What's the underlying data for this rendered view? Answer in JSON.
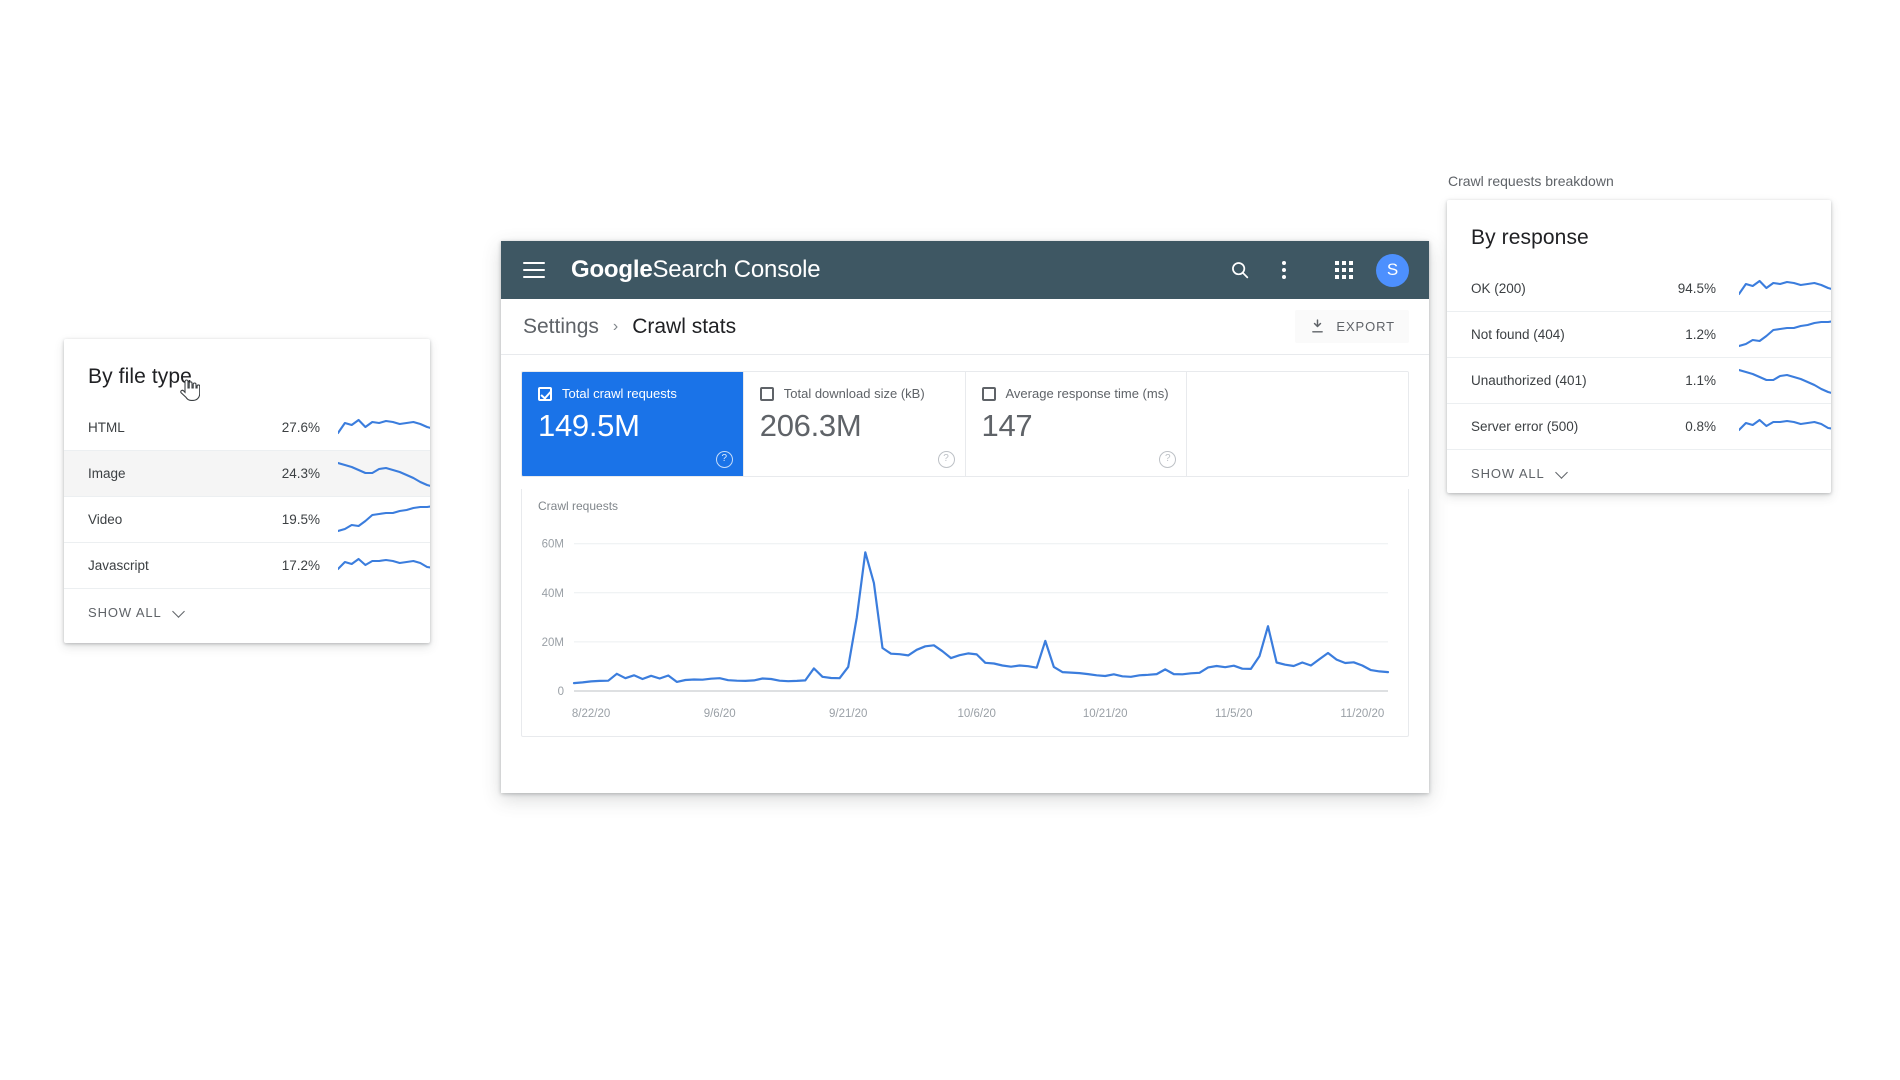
{
  "app": {
    "brand_bold": "Google",
    "brand_light": "Search Console",
    "header_bg": "#3e5763",
    "accent": "#1a73e8",
    "avatar_letter": "S",
    "avatar_bg": "#4d90fe",
    "icons": {
      "menu": "hamburger-icon",
      "search": "search-icon",
      "overflow": "more-vert-icon",
      "apps": "apps-grid-icon"
    }
  },
  "breadcrumb": {
    "parent": "Settings",
    "separator": "›",
    "current": "Crawl stats"
  },
  "export": {
    "label": "EXPORT",
    "icon": "download-icon"
  },
  "metrics": [
    {
      "name": "Total crawl requests",
      "value": "149.5M",
      "checked": true,
      "active": true,
      "help": "?"
    },
    {
      "name": "Total download size (kB)",
      "value": "206.3M",
      "checked": false,
      "active": false,
      "help": "?"
    },
    {
      "name": "Average response time (ms)",
      "value": "147",
      "checked": false,
      "active": false,
      "help": "?"
    }
  ],
  "chart_data": {
    "type": "line",
    "title": "Crawl requests",
    "xlabel": "",
    "ylabel": "",
    "grid": true,
    "legend": "none",
    "line_color": "#3b7ddd",
    "ylim": [
      0,
      66000000
    ],
    "yticks": [
      0,
      20000000,
      40000000,
      60000000
    ],
    "ytick_labels": [
      "0",
      "20M",
      "40M",
      "60M"
    ],
    "xtick_labels": [
      "8/22/20",
      "9/6/20",
      "9/21/20",
      "10/6/20",
      "10/21/20",
      "11/5/20",
      "11/20/20"
    ],
    "xtick_indices": [
      2,
      17,
      32,
      47,
      62,
      77,
      92
    ],
    "x": [
      "8/20/20",
      "8/21/20",
      "8/22/20",
      "8/23/20",
      "8/24/20",
      "8/25/20",
      "8/26/20",
      "8/27/20",
      "8/28/20",
      "8/29/20",
      "8/30/20",
      "8/31/20",
      "9/1/20",
      "9/2/20",
      "9/3/20",
      "9/4/20",
      "9/5/20",
      "9/6/20",
      "9/7/20",
      "9/8/20",
      "9/9/20",
      "9/10/20",
      "9/11/20",
      "9/12/20",
      "9/13/20",
      "9/14/20",
      "9/15/20",
      "9/16/20",
      "9/17/20",
      "9/18/20",
      "9/19/20",
      "9/20/20",
      "9/21/20",
      "9/22/20",
      "9/23/20",
      "9/24/20",
      "9/25/20",
      "9/26/20",
      "9/27/20",
      "9/28/20",
      "9/29/20",
      "9/30/20",
      "10/1/20",
      "10/2/20",
      "10/3/20",
      "10/4/20",
      "10/5/20",
      "10/6/20",
      "10/7/20",
      "10/8/20",
      "10/9/20",
      "10/10/20",
      "10/11/20",
      "10/12/20",
      "10/13/20",
      "10/14/20",
      "10/15/20",
      "10/16/20",
      "10/17/20",
      "10/18/20",
      "10/19/20",
      "10/20/20",
      "10/21/20",
      "10/22/20",
      "10/23/20",
      "10/24/20",
      "10/25/20",
      "10/26/20",
      "10/27/20",
      "10/28/20",
      "10/29/20",
      "10/30/20",
      "10/31/20",
      "11/1/20",
      "11/2/20",
      "11/3/20",
      "11/4/20",
      "11/5/20",
      "11/6/20",
      "11/7/20",
      "11/8/20",
      "11/9/20",
      "11/10/20",
      "11/11/20",
      "11/12/20",
      "11/13/20",
      "11/14/20",
      "11/15/20",
      "11/16/20",
      "11/17/20",
      "11/18/20",
      "11/19/20",
      "11/20/20",
      "11/21/20",
      "11/22/20",
      "11/23/20"
    ],
    "values": [
      3200000,
      3500000,
      3900000,
      4100000,
      4200000,
      7000000,
      5200000,
      6400000,
      4900000,
      6200000,
      5100000,
      6300000,
      3700000,
      4500000,
      4700000,
      4600000,
      5000000,
      5200000,
      4400000,
      4200000,
      4100000,
      4300000,
      5100000,
      4900000,
      4200000,
      4000000,
      4100000,
      4300000,
      9200000,
      5800000,
      5300000,
      5200000,
      9800000,
      30000000,
      56500000,
      44000000,
      17500000,
      15200000,
      15000000,
      14500000,
      16800000,
      18200000,
      18600000,
      16200000,
      13400000,
      14600000,
      15300000,
      14900000,
      11500000,
      11200000,
      10400000,
      9900000,
      10400000,
      10100000,
      9500000,
      20400000,
      9800000,
      7700000,
      7500000,
      7300000,
      6900000,
      6400000,
      6100000,
      6800000,
      6000000,
      5800000,
      6400000,
      6600000,
      6900000,
      8800000,
      6900000,
      6800000,
      7200000,
      7400000,
      9600000,
      10200000,
      9700000,
      10300000,
      9100000,
      9000000,
      14200000,
      26400000,
      11600000,
      10700000,
      10200000,
      11600000,
      10400000,
      13000000,
      15500000,
      12800000,
      11400000,
      11700000,
      10400000,
      8500000,
      8000000,
      7700000
    ]
  },
  "filetype_panel": {
    "title": "By file type",
    "rows": [
      {
        "label": "HTML",
        "pct": "27.6%",
        "trend": "flat-slight-down",
        "hovered": false
      },
      {
        "label": "Image",
        "pct": "24.3%",
        "trend": "down",
        "hovered": true
      },
      {
        "label": "Video",
        "pct": "19.5%",
        "trend": "up",
        "hovered": false
      },
      {
        "label": "Javascript",
        "pct": "17.2%",
        "trend": "flat",
        "hovered": false
      }
    ],
    "show_all": "SHOW ALL"
  },
  "response_panel": {
    "section_label": "Crawl requests breakdown",
    "title": "By response",
    "rows": [
      {
        "label": "OK (200)",
        "pct": "94.5%",
        "trend": "flat-slight-down"
      },
      {
        "label": "Not found (404)",
        "pct": "1.2%",
        "trend": "up"
      },
      {
        "label": "Unauthorized (401)",
        "pct": "1.1%",
        "trend": "down"
      },
      {
        "label": "Server error (500)",
        "pct": "0.8%",
        "trend": "flat"
      }
    ],
    "show_all": "SHOW ALL"
  },
  "cursor": {
    "type": "pointer-hand"
  }
}
